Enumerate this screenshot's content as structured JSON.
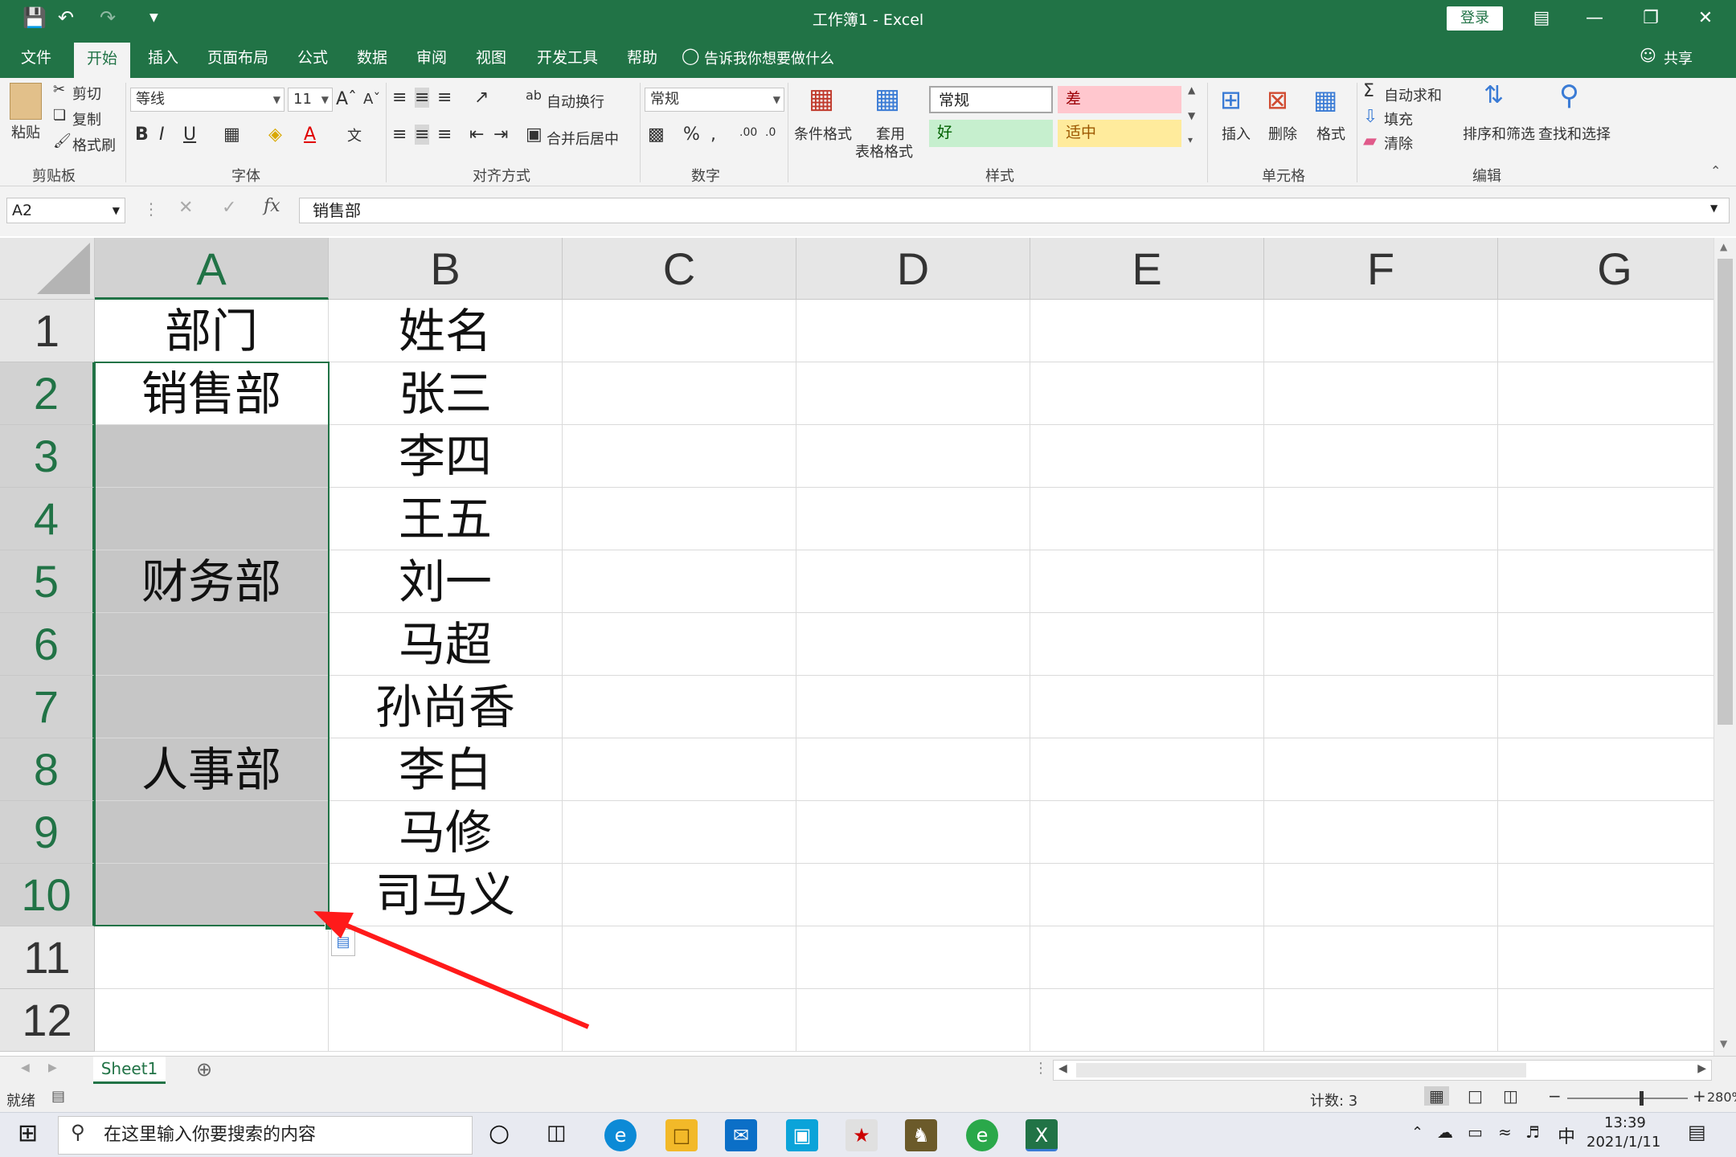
{
  "app": {
    "title": "工作簿1  -  Excel",
    "login_label": "登录"
  },
  "ribbon_tabs": [
    "文件",
    "开始",
    "插入",
    "页面布局",
    "公式",
    "数据",
    "审阅",
    "视图",
    "开发工具",
    "帮助"
  ],
  "tell_me": "告诉我你想要做什么",
  "share": "共享",
  "clipboard": {
    "paste": "粘贴",
    "cut": "剪切",
    "copy": "复制",
    "format_painter": "格式刷",
    "group": "剪贴板"
  },
  "font": {
    "name": "等线",
    "size": "11",
    "group": "字体"
  },
  "alignment": {
    "wrap": "自动换行",
    "merge": "合并后居中",
    "group": "对齐方式"
  },
  "number": {
    "format": "常规",
    "group": "数字"
  },
  "styles": {
    "conditional": "条件格式",
    "table_format_1": "套用",
    "table_format_2": "表格格式",
    "normal": "常规",
    "bad": "差",
    "good": "好",
    "neutral": "适中",
    "group": "样式"
  },
  "cells_group": {
    "insert": "插入",
    "delete": "删除",
    "format": "格式",
    "group": "单元格"
  },
  "editing": {
    "autosum": "自动求和",
    "fill": "填充",
    "clear": "清除",
    "sort": "排序和筛选",
    "find": "查找和选择",
    "group": "编辑"
  },
  "formula_bar": {
    "name_box": "A2",
    "value": "销售部"
  },
  "columns": [
    "A",
    "B",
    "C",
    "D",
    "E",
    "F",
    "G"
  ],
  "rows": [
    "1",
    "2",
    "3",
    "4",
    "5",
    "6",
    "7",
    "8",
    "9",
    "10",
    "11",
    "12"
  ],
  "cells": {
    "A1": "部门",
    "A2": "销售部",
    "A5": "财务部",
    "A8": "人事部",
    "B1": "姓名",
    "B2": "张三",
    "B3": "李四",
    "B4": "王五",
    "B5": "刘一",
    "B6": "马超",
    "B7": "孙尚香",
    "B8": "李白",
    "B9": "马修",
    "B10": "司马义"
  },
  "sheet_tab": "Sheet1",
  "status": {
    "ready": "就绪",
    "count": "计数: 3",
    "zoom": "280%"
  },
  "taskbar": {
    "search_placeholder": "在这里输入你要搜索的内容",
    "ime": "中",
    "time": "13:39",
    "date": "2021/1/11"
  },
  "colors": {
    "excel_green": "#217346",
    "bad_bg": "#ffc7ce",
    "good_bg": "#c6efce",
    "neutral_bg": "#ffeb9c",
    "arrow": "#ff1a1a"
  }
}
